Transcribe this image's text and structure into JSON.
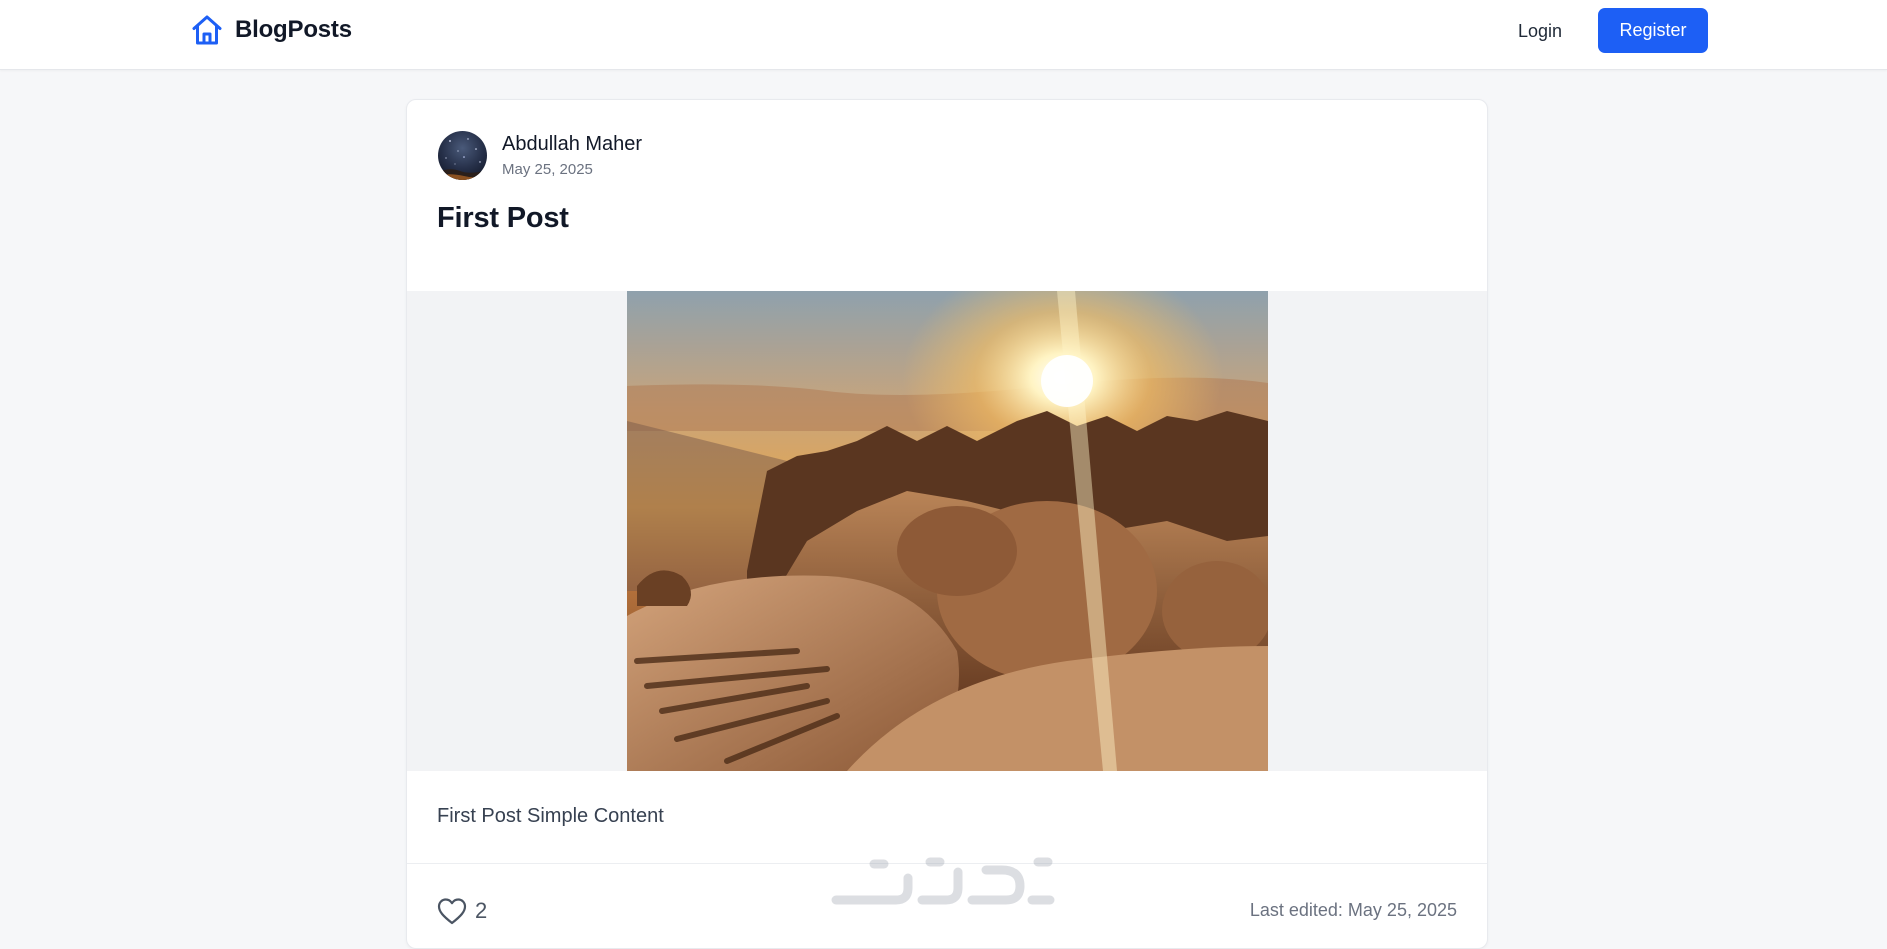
{
  "navbar": {
    "brand": "BlogPosts",
    "brand_icon": "home-icon",
    "login_label": "Login",
    "register_label": "Register",
    "accent_color": "#1d5ff5"
  },
  "post": {
    "author": "Abdullah Maher",
    "date": "May 25, 2025",
    "title": "First Post",
    "image": "mountain-sunrise-photo",
    "content": "First Post Simple Content",
    "likes": "2",
    "like_icon": "heart-outline-icon",
    "last_edited": "Last edited: May 25, 2025"
  },
  "watermark": "watermark-logo"
}
